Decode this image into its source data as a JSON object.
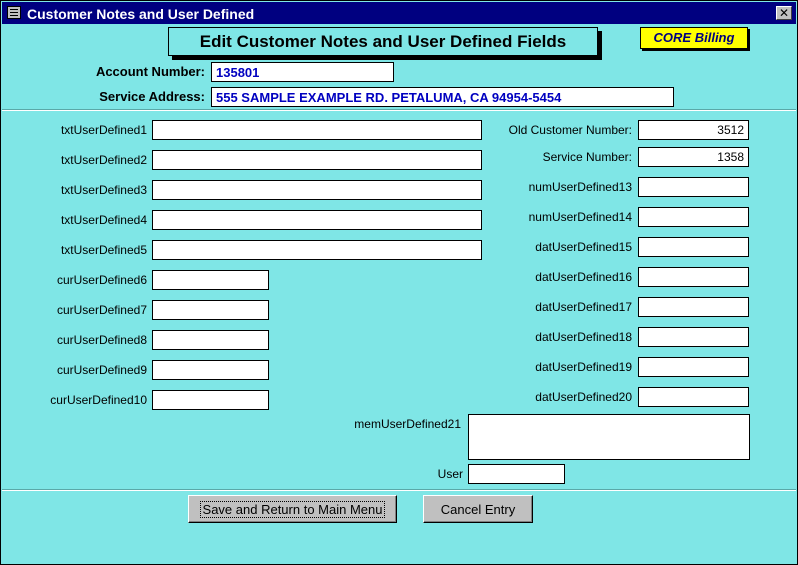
{
  "window": {
    "title": "Customer Notes and User Defined",
    "close_glyph": "✕"
  },
  "header": {
    "title": "Edit Customer Notes and User Defined Fields",
    "badge": "CORE Billing"
  },
  "account": {
    "number_label": "Account Number:",
    "number_value": "135801",
    "address_label": "Service Address:",
    "address_value": "555 SAMPLE EXAMPLE RD. PETALUMA, CA  94954-5454"
  },
  "left_fields": [
    {
      "label": "txtUserDefined1",
      "value": ""
    },
    {
      "label": "txtUserDefined2",
      "value": ""
    },
    {
      "label": "txtUserDefined3",
      "value": ""
    },
    {
      "label": "txtUserDefined4",
      "value": ""
    },
    {
      "label": "txtUserDefined5",
      "value": ""
    },
    {
      "label": "curUserDefined6",
      "value": ""
    },
    {
      "label": "curUserDefined7",
      "value": ""
    },
    {
      "label": "curUserDefined8",
      "value": ""
    },
    {
      "label": "curUserDefined9",
      "value": ""
    },
    {
      "label": "curUserDefined10",
      "value": ""
    }
  ],
  "right_fields": [
    {
      "label": "Old Customer Number:",
      "value": "3512"
    },
    {
      "label": "Service Number:",
      "value": "1358"
    },
    {
      "label": "numUserDefined13",
      "value": ""
    },
    {
      "label": "numUserDefined14",
      "value": ""
    },
    {
      "label": "datUserDefined15",
      "value": ""
    },
    {
      "label": "datUserDefined16",
      "value": ""
    },
    {
      "label": "datUserDefined17",
      "value": ""
    },
    {
      "label": "datUserDefined18",
      "value": ""
    },
    {
      "label": "datUserDefined19",
      "value": ""
    },
    {
      "label": "datUserDefined20",
      "value": ""
    }
  ],
  "memo": {
    "label": "memUserDefined21",
    "value": ""
  },
  "user": {
    "label": "User",
    "value": ""
  },
  "buttons": {
    "save": "Save and Return to Main Menu",
    "cancel": "Cancel Entry"
  },
  "colors": {
    "background": "#7fe6e6",
    "titlebar": "#000080",
    "badge": "#ffff00",
    "value_text": "#0000c0"
  }
}
